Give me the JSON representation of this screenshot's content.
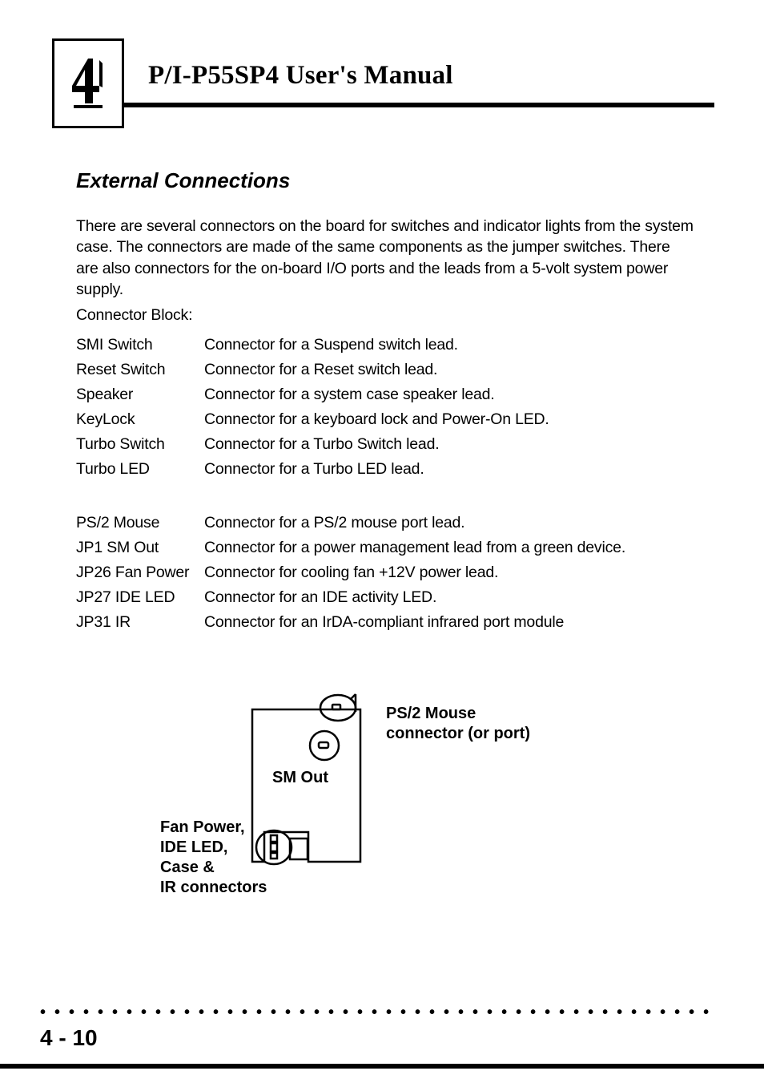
{
  "header": {
    "chapter_number": "4",
    "title": "P/I-P55SP4 User's Manual"
  },
  "section": {
    "title": "External Connections",
    "intro": "There are several connectors on the board for switches and indicator lights from the system case. The connectors are made of the same components as the jumper switches. There are also connectors for the on-board I/O ports and the leads from a 5-volt system power supply.",
    "block_label": "Connector Block:"
  },
  "defs_a": [
    {
      "k": "SMI Switch",
      "v": "Connector for a Suspend switch lead."
    },
    {
      "k": "Reset Switch",
      "v": "Connector for a Reset switch lead."
    },
    {
      "k": "Speaker",
      "v": "Connector for a system case speaker lead."
    },
    {
      "k": "KeyLock",
      "v": "Connector for a keyboard lock and Power-On LED."
    },
    {
      "k": "Turbo Switch",
      "v": "Connector for a Turbo Switch lead."
    },
    {
      "k": "Turbo LED",
      "v": "Connector for a Turbo LED lead."
    }
  ],
  "defs_b": [
    {
      "k": "PS/2 Mouse",
      "v": "Connector for a PS/2 mouse port lead."
    },
    {
      "k": "JP1 SM Out",
      "v": "Connector for a power management lead from a green device."
    },
    {
      "k": "JP26 Fan Power",
      "v": "Connector for cooling fan +12V power lead."
    },
    {
      "k": "JP27 IDE LED",
      "v": "Connector for an IDE activity LED."
    },
    {
      "k": "JP31 IR",
      "v": "Connector for an IrDA-compliant infrared port module"
    }
  ],
  "diagram": {
    "ps2_label_line1": "PS/2 Mouse",
    "ps2_label_line2": "connector (or port)",
    "sm_out_label": "SM Out",
    "left_label_line1": "Fan Power,",
    "left_label_line2": "IDE LED,",
    "left_label_line3": "Case &",
    "left_label_line4": "IR connectors"
  },
  "footer": {
    "page_number": "4 - 10"
  }
}
